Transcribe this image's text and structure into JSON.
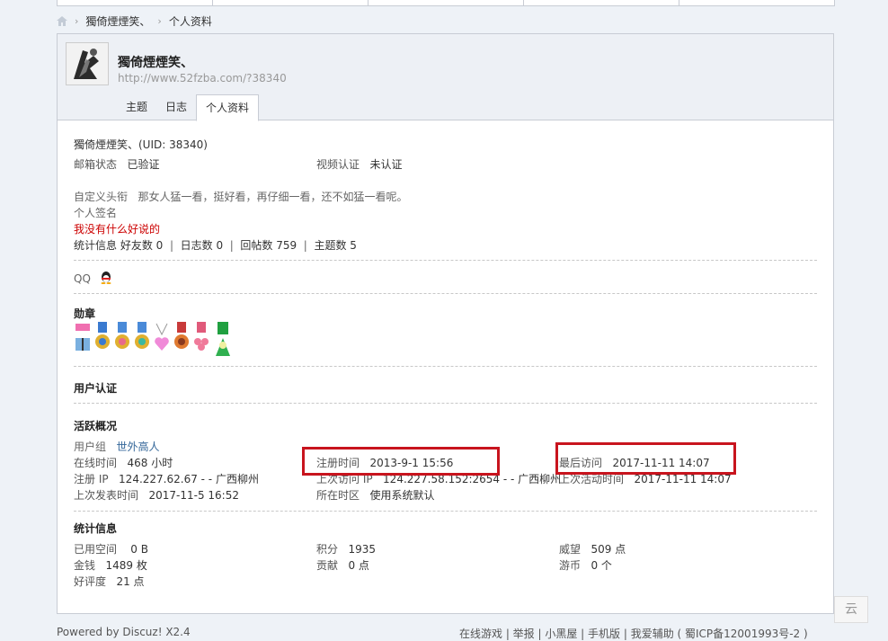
{
  "breadcrumb": {
    "home_icon": "home-icon",
    "user": "獨倚煙煙笑、",
    "page": "个人资料"
  },
  "header": {
    "username": "獨倚煙煙笑、",
    "url": "http://www.52fzba.com/?38340",
    "tabs": [
      "主题",
      "日志",
      "个人资料"
    ],
    "active_tab": "个人资料"
  },
  "profile": {
    "name_line": "獨倚煙煙笑、(UID: 38340)",
    "email_label": "邮箱状态",
    "email_value": "已验证",
    "video_label": "视频认证",
    "video_value": "未认证",
    "custom_title_label": "自定义头衔",
    "custom_title_value": "那女人猛一看，挺好看，再仔细一看，还不如猛一看呢。",
    "signature_label": "个人签名",
    "signature_value": "我没有什么好说的",
    "stats_label": "统计信息",
    "friends": "好友数 0",
    "blogs": "日志数 0",
    "replies": "回帖数 759",
    "threads": "主题数 5",
    "qq_label": "QQ",
    "medals_title": "勋章",
    "user_auth_title": "用户认证",
    "activity_title": "活跃概况",
    "group_label": "用户组",
    "group_value": "世外高人",
    "online_label": "在线时间",
    "online_value": "468 小时",
    "reg_time_label": "注册时间",
    "reg_time_value": "2013-9-1 15:56",
    "last_visit_label": "最后访问",
    "last_visit_value": "2017-11-11 14:07",
    "reg_ip_label": "注册 IP",
    "reg_ip_value": "124.227.62.67 - - 广西柳州",
    "last_ip_label": "上次访问 IP",
    "last_ip_value": "124.227.58.152:2654 - - 广西柳州",
    "last_active_label": "上次活动时间",
    "last_active_value": "2017-11-11 14:07",
    "last_post_label": "上次发表时间",
    "last_post_value": "2017-11-5 16:52",
    "timezone_label": "所在时区",
    "timezone_value": "使用系统默认",
    "stats_title": "统计信息",
    "space_label": "已用空间",
    "space_value": "0 B",
    "points_label": "积分",
    "points_value": "1935",
    "prestige_label": "威望",
    "prestige_value": "509 点",
    "money_label": "金钱",
    "money_value": "1489 枚",
    "contrib_label": "贡献",
    "contrib_value": "0 点",
    "coins_label": "游币",
    "coins_value": "0 个",
    "rating_label": "好评度",
    "rating_value": "21 点"
  },
  "footer": {
    "powered": "Powered by Discuz! X2.4",
    "links": "在线游戏 | 举报 | 小黑屋 | 手机版 | 我爱辅助 ( 蜀ICP备12001993号-2 )"
  },
  "cloud_badge": "云",
  "colors": {
    "highlight_box": "#c8141e",
    "signature": "#cc0000",
    "link": "#336699"
  }
}
